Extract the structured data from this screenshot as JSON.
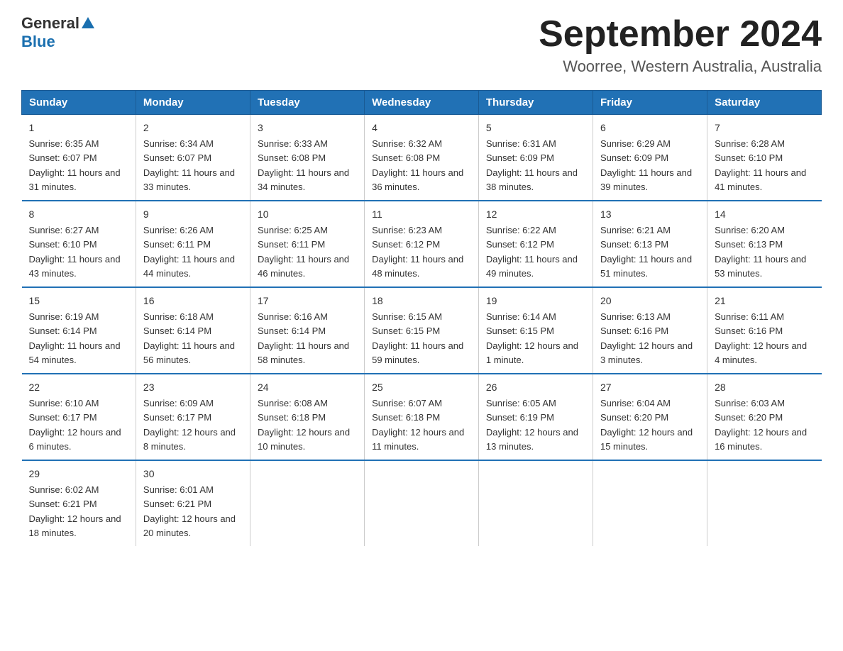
{
  "header": {
    "logo_general": "General",
    "logo_blue": "Blue",
    "title": "September 2024",
    "subtitle": "Woorree, Western Australia, Australia"
  },
  "days_of_week": [
    "Sunday",
    "Monday",
    "Tuesday",
    "Wednesday",
    "Thursday",
    "Friday",
    "Saturday"
  ],
  "weeks": [
    [
      {
        "day": "1",
        "sunrise": "6:35 AM",
        "sunset": "6:07 PM",
        "daylight": "11 hours and 31 minutes."
      },
      {
        "day": "2",
        "sunrise": "6:34 AM",
        "sunset": "6:07 PM",
        "daylight": "11 hours and 33 minutes."
      },
      {
        "day": "3",
        "sunrise": "6:33 AM",
        "sunset": "6:08 PM",
        "daylight": "11 hours and 34 minutes."
      },
      {
        "day": "4",
        "sunrise": "6:32 AM",
        "sunset": "6:08 PM",
        "daylight": "11 hours and 36 minutes."
      },
      {
        "day": "5",
        "sunrise": "6:31 AM",
        "sunset": "6:09 PM",
        "daylight": "11 hours and 38 minutes."
      },
      {
        "day": "6",
        "sunrise": "6:29 AM",
        "sunset": "6:09 PM",
        "daylight": "11 hours and 39 minutes."
      },
      {
        "day": "7",
        "sunrise": "6:28 AM",
        "sunset": "6:10 PM",
        "daylight": "11 hours and 41 minutes."
      }
    ],
    [
      {
        "day": "8",
        "sunrise": "6:27 AM",
        "sunset": "6:10 PM",
        "daylight": "11 hours and 43 minutes."
      },
      {
        "day": "9",
        "sunrise": "6:26 AM",
        "sunset": "6:11 PM",
        "daylight": "11 hours and 44 minutes."
      },
      {
        "day": "10",
        "sunrise": "6:25 AM",
        "sunset": "6:11 PM",
        "daylight": "11 hours and 46 minutes."
      },
      {
        "day": "11",
        "sunrise": "6:23 AM",
        "sunset": "6:12 PM",
        "daylight": "11 hours and 48 minutes."
      },
      {
        "day": "12",
        "sunrise": "6:22 AM",
        "sunset": "6:12 PM",
        "daylight": "11 hours and 49 minutes."
      },
      {
        "day": "13",
        "sunrise": "6:21 AM",
        "sunset": "6:13 PM",
        "daylight": "11 hours and 51 minutes."
      },
      {
        "day": "14",
        "sunrise": "6:20 AM",
        "sunset": "6:13 PM",
        "daylight": "11 hours and 53 minutes."
      }
    ],
    [
      {
        "day": "15",
        "sunrise": "6:19 AM",
        "sunset": "6:14 PM",
        "daylight": "11 hours and 54 minutes."
      },
      {
        "day": "16",
        "sunrise": "6:18 AM",
        "sunset": "6:14 PM",
        "daylight": "11 hours and 56 minutes."
      },
      {
        "day": "17",
        "sunrise": "6:16 AM",
        "sunset": "6:14 PM",
        "daylight": "11 hours and 58 minutes."
      },
      {
        "day": "18",
        "sunrise": "6:15 AM",
        "sunset": "6:15 PM",
        "daylight": "11 hours and 59 minutes."
      },
      {
        "day": "19",
        "sunrise": "6:14 AM",
        "sunset": "6:15 PM",
        "daylight": "12 hours and 1 minute."
      },
      {
        "day": "20",
        "sunrise": "6:13 AM",
        "sunset": "6:16 PM",
        "daylight": "12 hours and 3 minutes."
      },
      {
        "day": "21",
        "sunrise": "6:11 AM",
        "sunset": "6:16 PM",
        "daylight": "12 hours and 4 minutes."
      }
    ],
    [
      {
        "day": "22",
        "sunrise": "6:10 AM",
        "sunset": "6:17 PM",
        "daylight": "12 hours and 6 minutes."
      },
      {
        "day": "23",
        "sunrise": "6:09 AM",
        "sunset": "6:17 PM",
        "daylight": "12 hours and 8 minutes."
      },
      {
        "day": "24",
        "sunrise": "6:08 AM",
        "sunset": "6:18 PM",
        "daylight": "12 hours and 10 minutes."
      },
      {
        "day": "25",
        "sunrise": "6:07 AM",
        "sunset": "6:18 PM",
        "daylight": "12 hours and 11 minutes."
      },
      {
        "day": "26",
        "sunrise": "6:05 AM",
        "sunset": "6:19 PM",
        "daylight": "12 hours and 13 minutes."
      },
      {
        "day": "27",
        "sunrise": "6:04 AM",
        "sunset": "6:20 PM",
        "daylight": "12 hours and 15 minutes."
      },
      {
        "day": "28",
        "sunrise": "6:03 AM",
        "sunset": "6:20 PM",
        "daylight": "12 hours and 16 minutes."
      }
    ],
    [
      {
        "day": "29",
        "sunrise": "6:02 AM",
        "sunset": "6:21 PM",
        "daylight": "12 hours and 18 minutes."
      },
      {
        "day": "30",
        "sunrise": "6:01 AM",
        "sunset": "6:21 PM",
        "daylight": "12 hours and 20 minutes."
      },
      null,
      null,
      null,
      null,
      null
    ]
  ]
}
